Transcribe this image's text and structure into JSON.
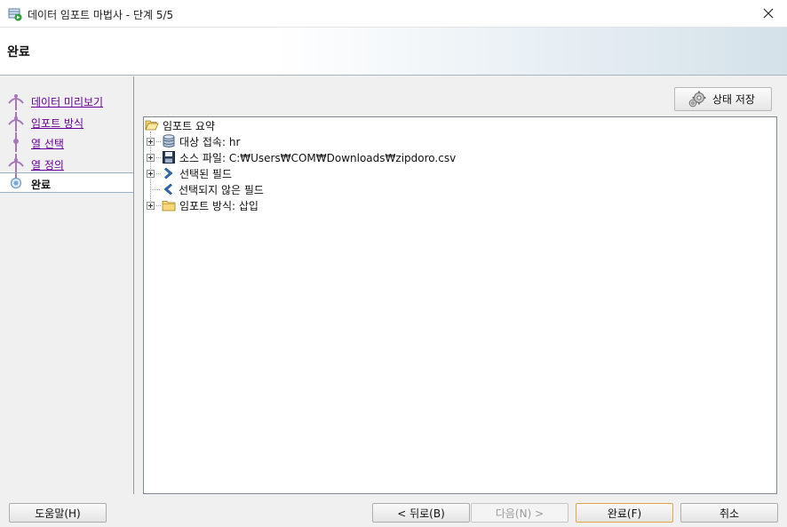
{
  "window": {
    "title": "데이터 임포트 마법사 - 단계 5/5"
  },
  "header": {
    "step_title": "완료"
  },
  "sidebar": {
    "items": [
      {
        "label": "데이터 미리보기",
        "visited": true
      },
      {
        "label": "임포트 방식",
        "visited": true
      },
      {
        "label": "열 선택",
        "visited": true
      },
      {
        "label": "열 정의",
        "visited": true
      },
      {
        "label": "완료",
        "active": true
      }
    ]
  },
  "toolbar": {
    "save_state_label": "상태 저장"
  },
  "tree": {
    "root": "임포트 요약",
    "items": [
      {
        "label": "대상 접속: hr",
        "icon": "database-icon",
        "expandable": true
      },
      {
        "label": "소스 파일: C:₩Users₩COM₩Downloads₩zipdoro.csv",
        "icon": "floppy-disk-icon",
        "expandable": true
      },
      {
        "label": "선택된 필드",
        "icon": "arrow-right-icon",
        "expandable": true
      },
      {
        "label": "선택되지 않은 필드",
        "icon": "arrow-left-icon",
        "expandable": false
      },
      {
        "label": "임포트 방식: 삽입",
        "icon": "folder-icon",
        "expandable": true
      }
    ]
  },
  "footer": {
    "help_label": "도움말(H)",
    "back_label": "< 뒤로(B)",
    "next_label": "다음(N) >",
    "finish_label": "완료(F)",
    "cancel_label": "취소"
  },
  "colors": {
    "link": "#660099",
    "accent_border": "#e6a348",
    "sidebar_line": "#a777b8"
  }
}
